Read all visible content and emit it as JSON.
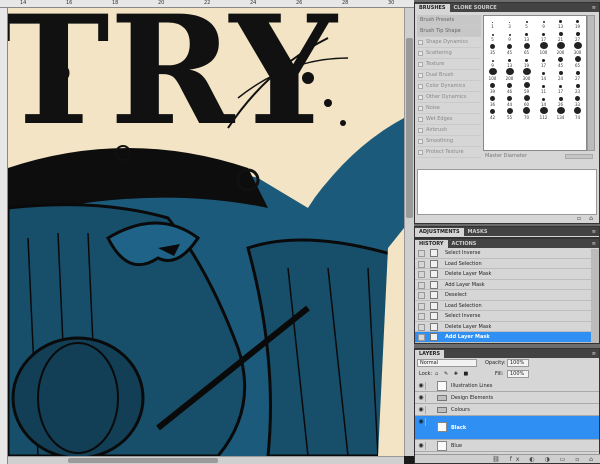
{
  "rulers": {
    "top_ticks": [
      "14",
      "16",
      "18",
      "20",
      "22",
      "24",
      "26",
      "28",
      "30"
    ]
  },
  "brushes_panel": {
    "tabs": [
      "BRUSHES",
      "CLONE SOURCE"
    ],
    "options": [
      "Brush Presets",
      "Brush Tip Shape",
      "Shape Dynamics",
      "Scattering",
      "Texture",
      "Dual Brush",
      "Color Dynamics",
      "Other Dynamics",
      "Noise",
      "Wet Edges",
      "Airbrush",
      "Smoothing",
      "Protect Texture"
    ],
    "brush_sizes": [
      "1",
      "3",
      "5",
      "9",
      "13",
      "19",
      "5",
      "9",
      "13",
      "17",
      "21",
      "27",
      "35",
      "45",
      "65",
      "100",
      "200",
      "300",
      "9",
      "13",
      "19",
      "17",
      "45",
      "65",
      "100",
      "200",
      "300",
      "14",
      "24",
      "27",
      "39",
      "46",
      "59",
      "11",
      "17",
      "23",
      "36",
      "44",
      "60",
      "14",
      "26",
      "33",
      "42",
      "55",
      "70",
      "112",
      "134",
      "74"
    ],
    "master_diameter_label": "Master Diameter"
  },
  "adjustments_panel": {
    "tabs": [
      "ADJUSTMENTS",
      "MASKS"
    ]
  },
  "history_panel": {
    "tabs": [
      "HISTORY",
      "ACTIONS"
    ],
    "items": [
      {
        "label": "Select Inverse",
        "selected": false
      },
      {
        "label": "Load Selection",
        "selected": false
      },
      {
        "label": "Delete Layer Mask",
        "selected": false
      },
      {
        "label": "Add Layer Mask",
        "selected": false
      },
      {
        "label": "Deselect",
        "selected": false
      },
      {
        "label": "Load Selection",
        "selected": false
      },
      {
        "label": "Select Inverse",
        "selected": false
      },
      {
        "label": "Delete Layer Mask",
        "selected": false
      },
      {
        "label": "Add Layer Mask",
        "selected": true
      }
    ]
  },
  "layers_panel": {
    "tabs": [
      "LAYERS"
    ],
    "blend_mode": "Normal",
    "opacity_label": "Opacity:",
    "opacity_value": "100%",
    "lock_label": "Lock:",
    "fill_label": "Fill:",
    "fill_value": "100%",
    "layers": [
      {
        "name": "Illustration Lines",
        "kind": "layer"
      },
      {
        "name": "Design Elements",
        "kind": "folder"
      },
      {
        "name": "Colours",
        "kind": "folder"
      },
      {
        "name": "Black",
        "kind": "layer",
        "selected": true
      },
      {
        "name": "Blue",
        "kind": "layer"
      }
    ]
  },
  "colors": {
    "teal": "#1b5a7a",
    "cream": "#f2e4c4",
    "selection_blue": "#2f8ff3",
    "panel_bg": "#d6d6d6"
  }
}
